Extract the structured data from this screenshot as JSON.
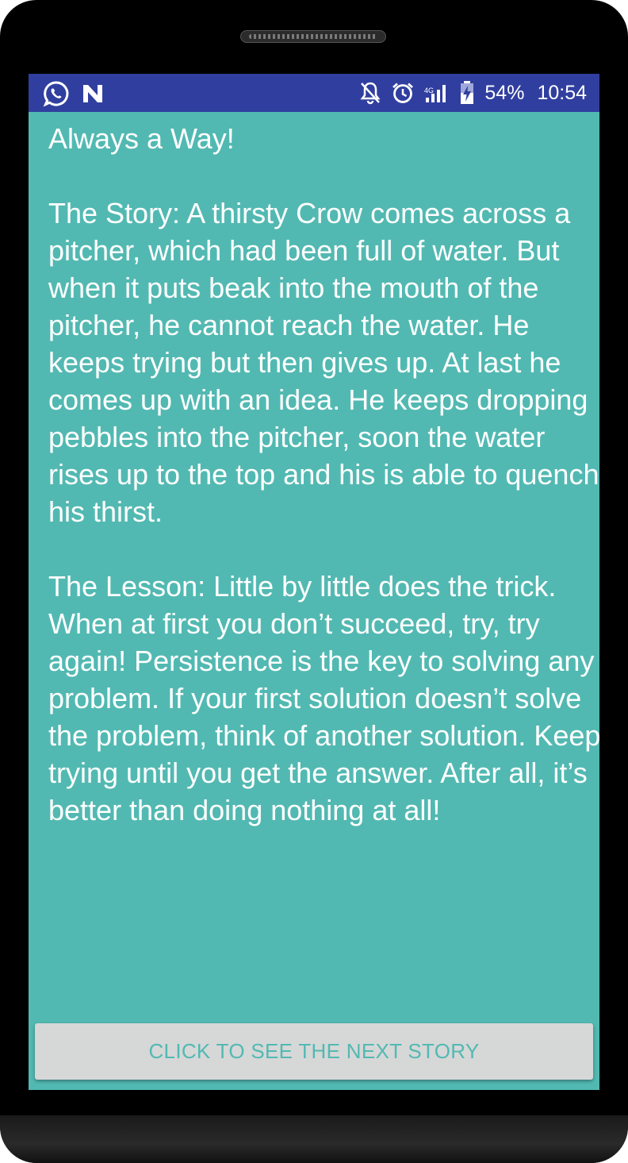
{
  "status_bar": {
    "battery_percent": "54%",
    "time": "10:54",
    "left_icons": [
      "whatsapp-icon",
      "n-notification-icon"
    ],
    "right_icons": [
      "notifications-off-icon",
      "alarm-icon",
      "signal-icon",
      "battery-charging-icon"
    ]
  },
  "story": {
    "title": "Always a Way!",
    "story_text": "The Story: A thirsty Crow comes across a pitcher, which had been full of water. But when it puts beak into the mouth of the pitcher, he cannot reach the water. He keeps trying but then gives up. At last he comes up with an idea. He keeps dropping pebbles into the pitcher, soon the water rises up to the top and his is able to quench his thirst.",
    "lesson_text": "The Lesson: Little by little does the trick. When at first you don’t succeed, try, try again! Persistence is the key to solving any problem. If your first solution doesn’t solve the problem, think of another solution. Keep trying until you get the answer. After all, it’s better than doing nothing at all!"
  },
  "next_button": {
    "label": "CLICK TO SEE THE NEXT STORY"
  },
  "colors": {
    "status_bar": "#303f9f",
    "screen_background": "#52b9b2",
    "button_background": "#d6d7d7",
    "button_text": "#52b9b2",
    "text": "#ffffff"
  }
}
